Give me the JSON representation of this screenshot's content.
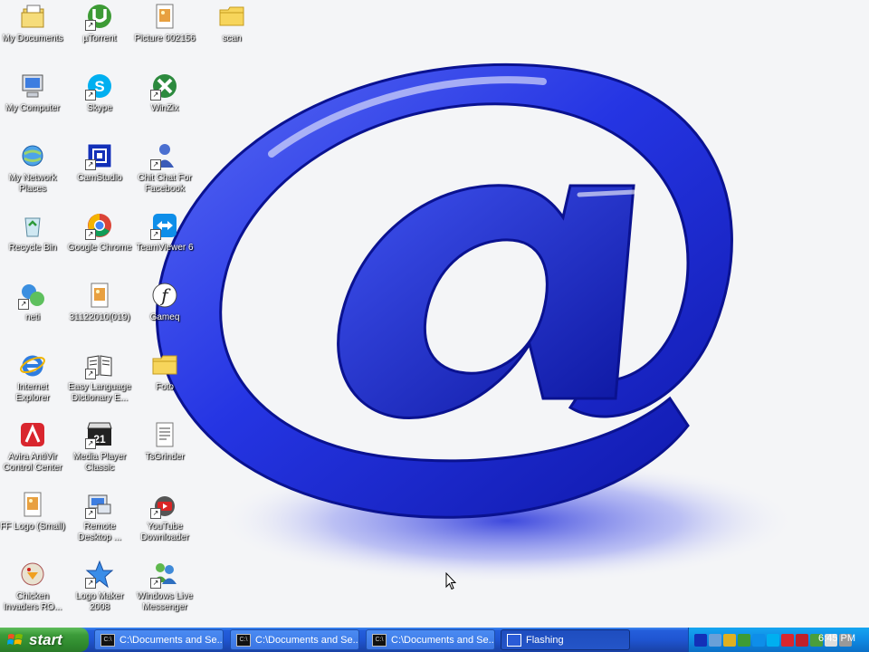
{
  "desktop": {
    "icons": [
      {
        "label": "My Documents",
        "icon": "my-documents-icon",
        "col": 0,
        "row": 0,
        "shortcut": false
      },
      {
        "label": "My Computer",
        "icon": "my-computer-icon",
        "col": 0,
        "row": 1,
        "shortcut": false
      },
      {
        "label": "My Network Places",
        "icon": "network-places-icon",
        "col": 0,
        "row": 2,
        "shortcut": false
      },
      {
        "label": "Recycle Bin",
        "icon": "recycle-bin-icon",
        "col": 0,
        "row": 3,
        "shortcut": false
      },
      {
        "label": "neti",
        "icon": "neti-icon",
        "col": 0,
        "row": 4,
        "shortcut": true
      },
      {
        "label": "Internet Explorer",
        "icon": "internet-explorer-icon",
        "col": 0,
        "row": 5,
        "shortcut": false
      },
      {
        "label": "Avira AntiVir Control Center",
        "icon": "avira-icon",
        "col": 0,
        "row": 6,
        "shortcut": false
      },
      {
        "label": "FF Logo (Small)",
        "icon": "image-file-icon",
        "col": 0,
        "row": 7,
        "shortcut": false
      },
      {
        "label": "Chicken Invaders RO...",
        "icon": "chicken-invaders-icon",
        "col": 0,
        "row": 8,
        "shortcut": false
      },
      {
        "label": "µTorrent",
        "icon": "utorrent-icon",
        "col": 1,
        "row": 0,
        "shortcut": true
      },
      {
        "label": "Skype",
        "icon": "skype-icon",
        "col": 1,
        "row": 1,
        "shortcut": true
      },
      {
        "label": "CamStudio",
        "icon": "camstudio-icon",
        "col": 1,
        "row": 2,
        "shortcut": true
      },
      {
        "label": "Google Chrome",
        "icon": "chrome-icon",
        "col": 1,
        "row": 3,
        "shortcut": true
      },
      {
        "label": "31122010(019)",
        "icon": "image-file-icon",
        "col": 1,
        "row": 4,
        "shortcut": false
      },
      {
        "label": "Easy Language Dictionary E...",
        "icon": "dictionary-icon",
        "col": 1,
        "row": 5,
        "shortcut": true
      },
      {
        "label": "Media Player Classic",
        "icon": "media-player-icon",
        "col": 1,
        "row": 6,
        "shortcut": true
      },
      {
        "label": "Remote Desktop ...",
        "icon": "remote-desktop-icon",
        "col": 1,
        "row": 7,
        "shortcut": true
      },
      {
        "label": "Logo Maker 2008",
        "icon": "logo-maker-icon",
        "col": 1,
        "row": 8,
        "shortcut": true
      },
      {
        "label": "Picture 002156",
        "icon": "image-file-icon",
        "col": 2,
        "row": 0,
        "shortcut": false
      },
      {
        "label": "WinZix",
        "icon": "winzix-icon",
        "col": 2,
        "row": 1,
        "shortcut": true
      },
      {
        "label": "Chit Chat For Facebook",
        "icon": "chit-chat-icon",
        "col": 2,
        "row": 2,
        "shortcut": true
      },
      {
        "label": "TeamViewer 6",
        "icon": "teamviewer-icon",
        "col": 2,
        "row": 3,
        "shortcut": true
      },
      {
        "label": "Gameq",
        "icon": "flash-icon",
        "col": 2,
        "row": 4,
        "shortcut": false
      },
      {
        "label": "Foto",
        "icon": "folder-icon",
        "col": 2,
        "row": 5,
        "shortcut": false
      },
      {
        "label": "TsGrinder",
        "icon": "text-file-icon",
        "col": 2,
        "row": 6,
        "shortcut": false
      },
      {
        "label": "YouTube Downloader",
        "icon": "youtube-downloader-icon",
        "col": 2,
        "row": 7,
        "shortcut": true
      },
      {
        "label": "Windows Live Messenger",
        "icon": "messenger-icon",
        "col": 2,
        "row": 8,
        "shortcut": true
      },
      {
        "label": "scan",
        "icon": "folder-icon",
        "col": 3,
        "row": 0,
        "shortcut": false
      }
    ]
  },
  "taskbar": {
    "start_label": "start",
    "tasks": [
      {
        "label": "C:\\Documents and Se...",
        "icon": "console-icon",
        "active": false
      },
      {
        "label": "C:\\Documents and Se...",
        "icon": "console-icon",
        "active": false
      },
      {
        "label": "C:\\Documents and Se...",
        "icon": "console-icon",
        "active": false
      },
      {
        "label": "Flashing",
        "icon": "window-icon",
        "active": true
      }
    ],
    "clock": "6:45 PM",
    "tray_icons": [
      "camstudio-tray-icon",
      "network-tray-icon",
      "security-tray-icon",
      "utorrent-tray-icon",
      "teamviewer-tray-icon",
      "skype-tray-icon",
      "avira-tray-icon",
      "adobe-tray-icon",
      "messenger-tray-icon",
      "volume-tray-icon",
      "update-tray-icon"
    ]
  },
  "colors": {
    "accent": "#245edb",
    "start_green": "#3c9b3a",
    "wallpaper_blue": "#2d3fe6"
  }
}
